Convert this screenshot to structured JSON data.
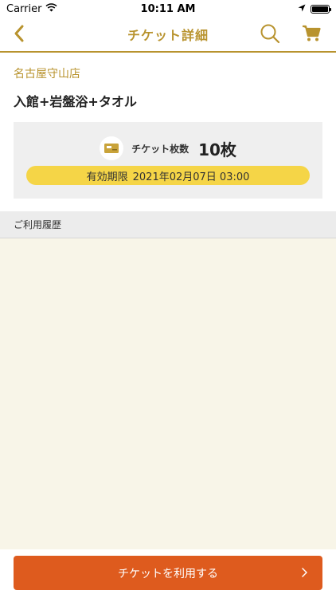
{
  "status_bar": {
    "carrier": "Carrier",
    "time": "10:11 AM"
  },
  "nav": {
    "title": "チケット詳細",
    "back_icon": "chevron-left-icon",
    "search_icon": "search-icon",
    "cart_icon": "cart-icon"
  },
  "ticket": {
    "store": "名古屋守山店",
    "name": "入館+岩盤浴+タオル",
    "count_label": "チケット枚数",
    "count_value": "10枚",
    "expiry_label": "有効期限",
    "expiry_value": "2021年02月07日 03:00"
  },
  "history": {
    "header": "ご利用履歴"
  },
  "action": {
    "use_label": "チケットを利用する"
  },
  "colors": {
    "accent": "#b8932e",
    "button": "#de5b1e",
    "expiry_pill": "#f5d547",
    "history_bg": "#f8f5e8"
  }
}
